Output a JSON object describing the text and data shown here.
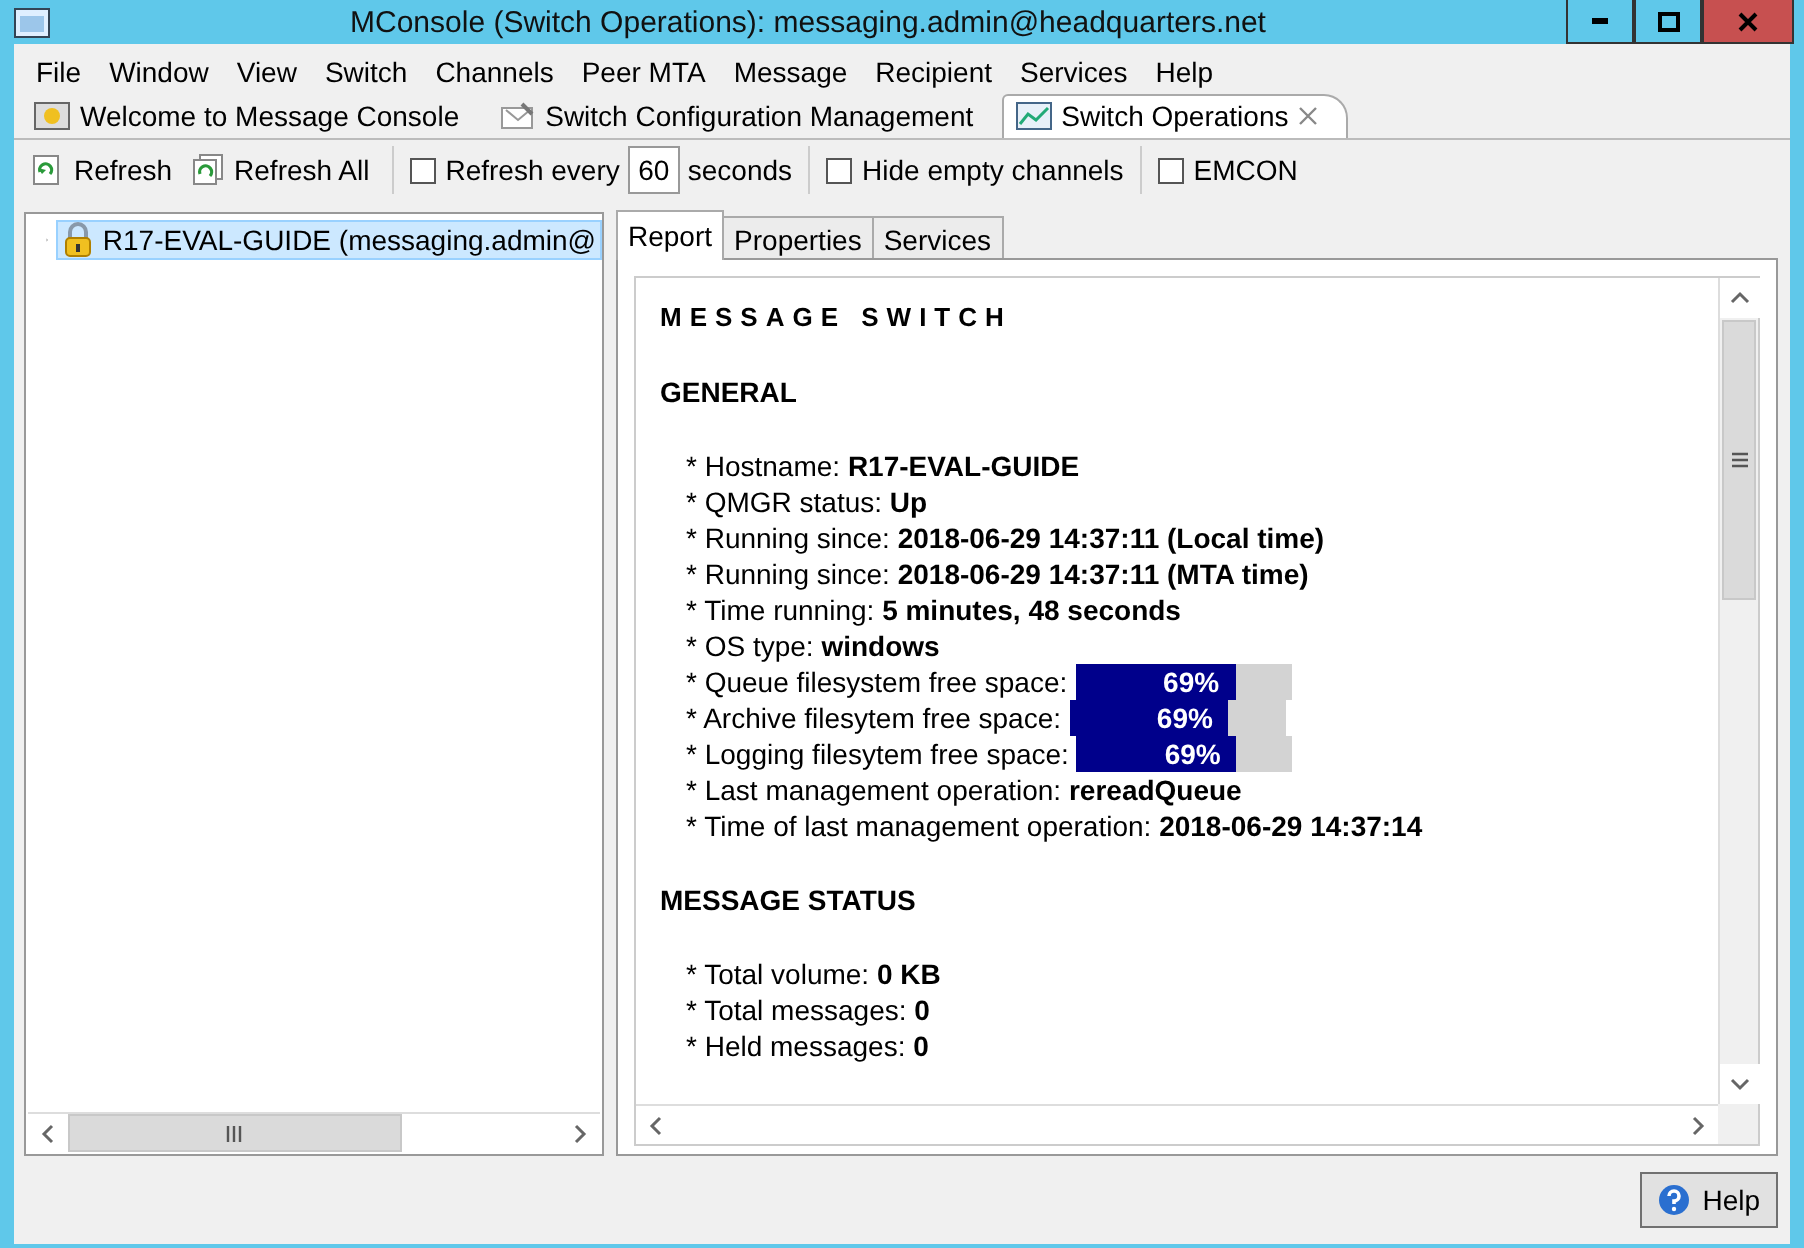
{
  "window": {
    "title": "MConsole (Switch Operations): messaging.admin@headquarters.net"
  },
  "menu": [
    "File",
    "Window",
    "View",
    "Switch",
    "Channels",
    "Peer MTA",
    "Message",
    "Recipient",
    "Services",
    "Help"
  ],
  "editor_tabs": [
    {
      "label": "Welcome to Message Console",
      "selected": false,
      "closable": false
    },
    {
      "label": "Switch Configuration Management",
      "selected": false,
      "closable": false
    },
    {
      "label": "Switch Operations",
      "selected": true,
      "closable": true
    }
  ],
  "toolbar": [
    {
      "kind": "button",
      "label": "Refresh"
    },
    {
      "kind": "button",
      "label": "Refresh All"
    },
    {
      "kind": "separator"
    },
    {
      "kind": "checkbox",
      "label": "Refresh every",
      "checked": false
    },
    {
      "kind": "number",
      "value": "60"
    },
    {
      "kind": "text",
      "label": "seconds"
    },
    {
      "kind": "separator"
    },
    {
      "kind": "checkbox",
      "label": "Hide empty channels",
      "checked": false
    },
    {
      "kind": "separator"
    },
    {
      "kind": "checkbox",
      "label": "EMCON",
      "checked": false
    }
  ],
  "tree": [
    {
      "label": "R17-EVAL-GUIDE (messaging.admin@",
      "selected": true,
      "expanded": false
    }
  ],
  "report_tabs": [
    {
      "label": "Report",
      "selected": true
    },
    {
      "label": "Properties",
      "selected": false
    },
    {
      "label": "Services",
      "selected": false
    }
  ],
  "report": {
    "title": "MESSAGE SWITCH",
    "sections": [
      {
        "heading": "GENERAL",
        "lines": [
          {
            "kind": "text",
            "text": "* Hostname: **R17-EVAL-GUIDE**"
          },
          {
            "kind": "text",
            "text": "* QMGR status: **Up**"
          },
          {
            "kind": "text",
            "text": "* Running since: **2018-06-29 14:37:11 (Local time)**"
          },
          {
            "kind": "text",
            "text": "* Running since: **2018-06-29 14:37:11 (MTA time)**"
          },
          {
            "kind": "text",
            "text": "* Time running: **5 minutes, 48 seconds**"
          },
          {
            "kind": "text",
            "text": "* OS type: **windows**"
          },
          {
            "kind": "bar",
            "label": "* Queue filesystem free space:",
            "level": 0.74,
            "reading": "69%"
          },
          {
            "kind": "bar",
            "label": "* Archive filesytem free space:",
            "level": 0.74,
            "reading": "69%"
          },
          {
            "kind": "bar",
            "label": "* Logging filesytem free space:",
            "level": 0.74,
            "reading": "69%"
          },
          {
            "kind": "text",
            "text": "* Last management operation: **rereadQueue**"
          },
          {
            "kind": "text",
            "text": "* Time of last management operation: **2018-06-29 14:37:14**"
          }
        ]
      },
      {
        "heading": "MESSAGE STATUS",
        "lines": [
          {
            "kind": "text",
            "text": "* Total volume: **0 KB**"
          },
          {
            "kind": "text",
            "text": "* Total messages: **0**"
          },
          {
            "kind": "text",
            "text": "* Held messages: **0**"
          }
        ]
      }
    ]
  },
  "help_button": {
    "label": "Help"
  }
}
